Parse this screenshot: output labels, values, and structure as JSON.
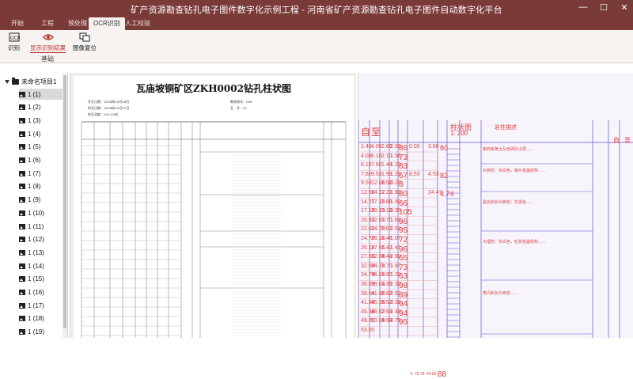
{
  "app": {
    "title": "矿产资源勘查钻孔电子图件数字化示例工程 - 河南省矿产资源勘查钻孔电子图件自动数字化平台",
    "window_controls": [
      "—",
      "☐",
      "✕"
    ]
  },
  "menu": {
    "tabs": [
      "开始",
      "工程",
      "预处理",
      "OCR识别",
      "人工校验"
    ],
    "active": "OCR识别"
  },
  "ribbon": {
    "buttons": [
      {
        "label": "识别",
        "icon": "ocr-icon"
      },
      {
        "label": "显示识别结果",
        "icon": "eye-icon"
      },
      {
        "label": "图像复位",
        "icon": "reset-image-icon"
      }
    ],
    "group_label": "基础"
  },
  "tree": {
    "root": "未命名项目1",
    "items": [
      "1 (1)",
      "1 (2)",
      "1 (3)",
      "1 (4)",
      "1 (5)",
      "1 (6)",
      "1 (7)",
      "1 (8)",
      "1 (9)",
      "1 (10)",
      "1 (11)",
      "1 (12)",
      "1 (13)",
      "1 (14)",
      "1 (15)",
      "1 (16)",
      "1 (17)",
      "1 (18)",
      "1 (19)"
    ],
    "selected": "1 (1)"
  },
  "document": {
    "title": "瓦庙坡铜矿区ZKH0002钻孔柱状图",
    "meta_lines": [
      "开孔日期：2004年03月04日",
      "终孔日期：2004年05月15日",
      "终孔深度：200.30米"
    ],
    "meta_right": [
      "勘探线号：008",
      "孔　号：02"
    ]
  },
  "ocr": {
    "header_left": [
      "自",
      "至"
    ],
    "header_mid": "柱状图",
    "header_scale": "1: 200",
    "header_right": "岩性描述",
    "header_far": [
      "自",
      "至"
    ],
    "rows": [
      [
        "1.40",
        "4.06",
        "2.66",
        "2.30",
        "86",
        "0.00",
        "3.60",
        "80"
      ],
      [
        "4.06",
        "6.16",
        "2.10",
        "1.56",
        "73",
        "",
        "",
        ""
      ],
      [
        "6.16",
        "7.60",
        "1.44",
        "1.20",
        "83",
        "",
        "",
        ""
      ],
      [
        "7.60",
        "9.53",
        "1.93",
        "1.29",
        "67",
        "8.53",
        "4.53",
        "82"
      ],
      [
        "9.53",
        "12.06",
        "2.50",
        "0.20",
        "8",
        "",
        "",
        ""
      ],
      [
        "12.06",
        "14.27",
        "2.21",
        "1.80",
        "80",
        "",
        "24.47",
        "4.74"
      ],
      [
        "14.27",
        "17.15",
        "2.88",
        "1.90",
        "66",
        "",
        "",
        ""
      ],
      [
        "17.15",
        "20.33",
        "3.18",
        "3.35",
        "105",
        "",
        "",
        ""
      ],
      [
        "20.33",
        "22.03",
        "1.70",
        "1.63",
        "96",
        "",
        "",
        ""
      ],
      [
        "22.03",
        "24.70",
        "2.67",
        "2.53",
        "95",
        "",
        "",
        ""
      ],
      [
        "24.70",
        "26.18",
        "1.48",
        "1.07",
        "72",
        "",
        "",
        ""
      ],
      [
        "26.18",
        "27.65",
        "1.47",
        "1.41",
        "96",
        "",
        "",
        ""
      ],
      [
        "27.65",
        "32.09",
        "4.44",
        "2.90",
        "65",
        "",
        "",
        ""
      ],
      [
        "32.09",
        "34.79",
        "2.70",
        "1.97",
        "73",
        "",
        "",
        ""
      ],
      [
        "34.79",
        "36.69",
        "1.90",
        "1.20",
        "63",
        "",
        "",
        ""
      ],
      [
        "36.69",
        "39.04",
        "2.35",
        "2.30",
        "98",
        "",
        "",
        ""
      ],
      [
        "39.04",
        "41.86",
        "2.82",
        "2.52",
        "89",
        "",
        "",
        ""
      ],
      [
        "41.86",
        "45.38",
        "3.52",
        "3.30",
        "94",
        "",
        "",
        ""
      ],
      [
        "45.38",
        "48.02",
        "2.64",
        "2.49",
        "94",
        "",
        "",
        ""
      ],
      [
        "48.02",
        "53.00",
        "4.98",
        "4.75",
        "95",
        "",
        "",
        ""
      ],
      [
        "53.00",
        "",
        "",
        "",
        "",
        "",
        "",
        ""
      ]
    ],
    "side_values": [
      "5",
      "75.78",
      "44.80",
      "88"
    ],
    "descriptions": [
      "第四系黄土及含砾砂土层……",
      "片麻岩：灰白色，鳞片变晶结构……",
      "黑云斜长片麻岩：灰黑色……",
      "大理岩：灰白色，粒状变晶结构……",
      "角闪斜长片麻岩……"
    ]
  }
}
